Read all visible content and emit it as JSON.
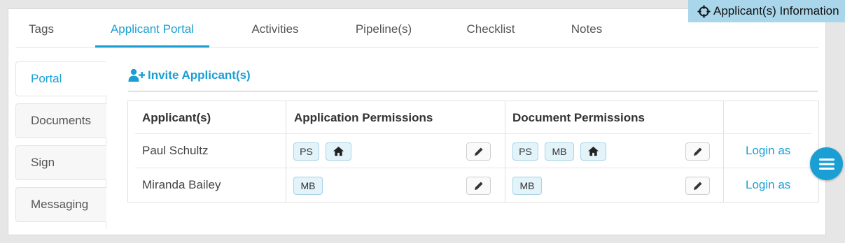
{
  "info_badge": {
    "label": "Applicant(s) Information",
    "icon": "crosshair-icon"
  },
  "tabs": [
    {
      "label": "Tags"
    },
    {
      "label": "Applicant Portal",
      "active": true
    },
    {
      "label": "Activities"
    },
    {
      "label": "Pipeline(s)"
    },
    {
      "label": "Checklist"
    },
    {
      "label": "Notes"
    }
  ],
  "sidenav": [
    {
      "label": "Portal",
      "active": true
    },
    {
      "label": "Documents"
    },
    {
      "label": "Sign"
    },
    {
      "label": "Messaging"
    }
  ],
  "invite": {
    "label": "Invite Applicant(s)",
    "icon": "user-plus-icon"
  },
  "table": {
    "headers": {
      "applicants": "Applicant(s)",
      "application_permissions": "Application Permissions",
      "document_permissions": "Document Permissions"
    },
    "rows": [
      {
        "name": "Paul Schultz",
        "app_permissions": [
          "PS",
          "home"
        ],
        "doc_permissions": [
          "PS",
          "MB",
          "home"
        ],
        "login_label": "Login as"
      },
      {
        "name": "Miranda Bailey",
        "app_permissions": [
          "MB"
        ],
        "doc_permissions": [
          "MB"
        ],
        "login_label": "Login as"
      }
    ]
  },
  "colors": {
    "accent": "#1a9fd4",
    "badge_bg": "#a9d6ea",
    "chip_bg": "#e2f3fa"
  }
}
